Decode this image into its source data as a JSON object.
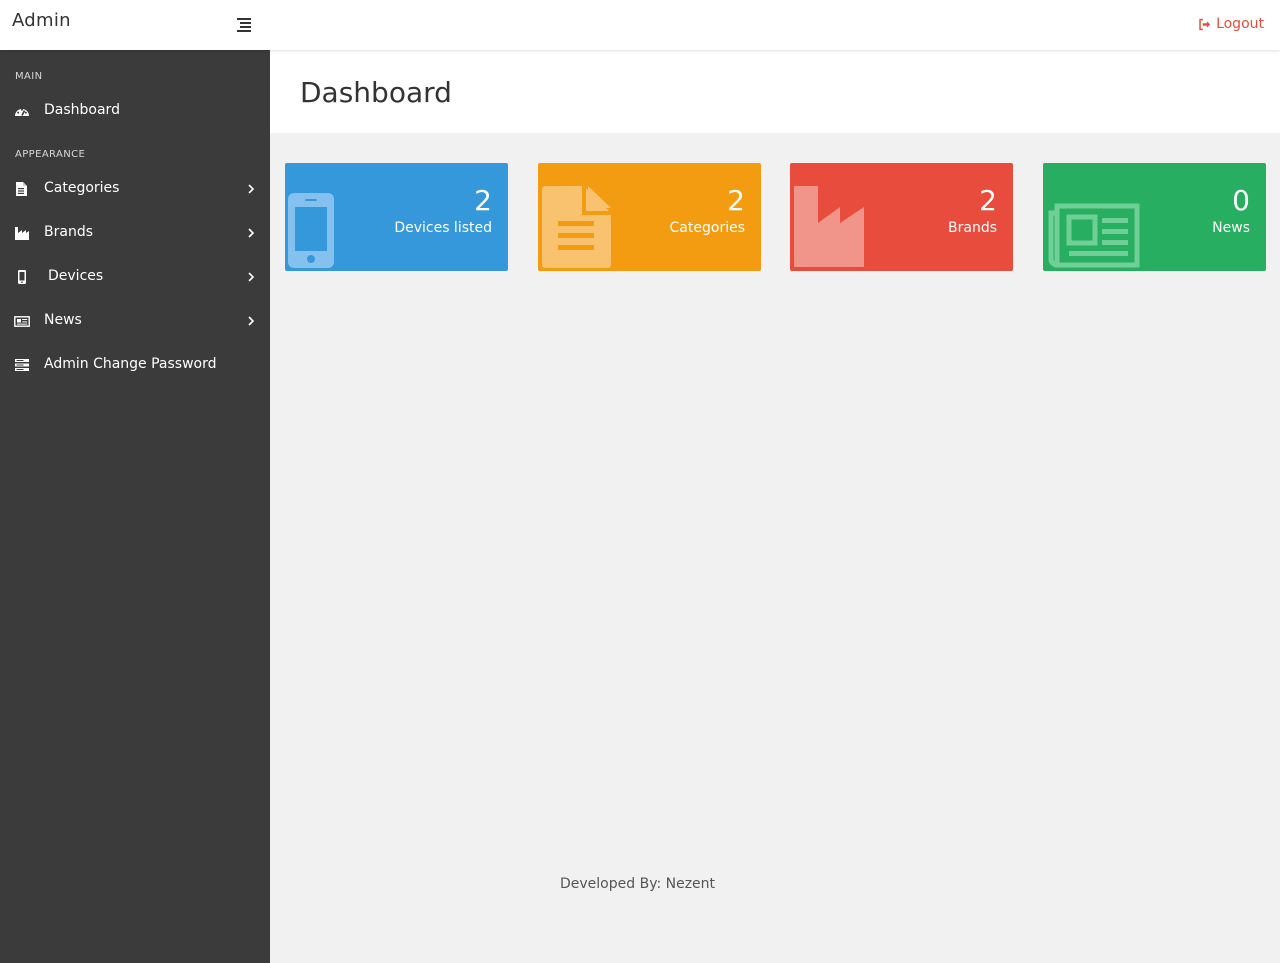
{
  "header": {
    "title": "Admin",
    "logout_label": "Logout"
  },
  "sidebar": {
    "main_label": "MAIN",
    "appearance_label": "APPEARANCE",
    "items": [
      {
        "label": "Dashboard",
        "icon": "dashboard-icon"
      },
      {
        "label": "Categories",
        "icon": "file-icon",
        "has_submenu": true
      },
      {
        "label": "Brands",
        "icon": "industry-icon",
        "has_submenu": true
      },
      {
        "label": "Devices",
        "icon": "mobile-icon",
        "has_submenu": true
      },
      {
        "label": "News",
        "icon": "newspaper-icon",
        "has_submenu": true
      },
      {
        "label": "Admin Change Password",
        "icon": "server-icon"
      }
    ]
  },
  "page": {
    "title": "Dashboard"
  },
  "cards": [
    {
      "count": "2",
      "label": "Devices listed",
      "color": "#3498db",
      "icon": "mobile-icon"
    },
    {
      "count": "2",
      "label": "Categories",
      "color": "#f39c12",
      "icon": "file-icon"
    },
    {
      "count": "2",
      "label": "Brands",
      "color": "#e74c3c",
      "icon": "industry-icon"
    },
    {
      "count": "0",
      "label": "News",
      "color": "#27ae60",
      "icon": "newspaper-icon"
    }
  ],
  "footer": {
    "text": "Developed By: Nezent"
  }
}
